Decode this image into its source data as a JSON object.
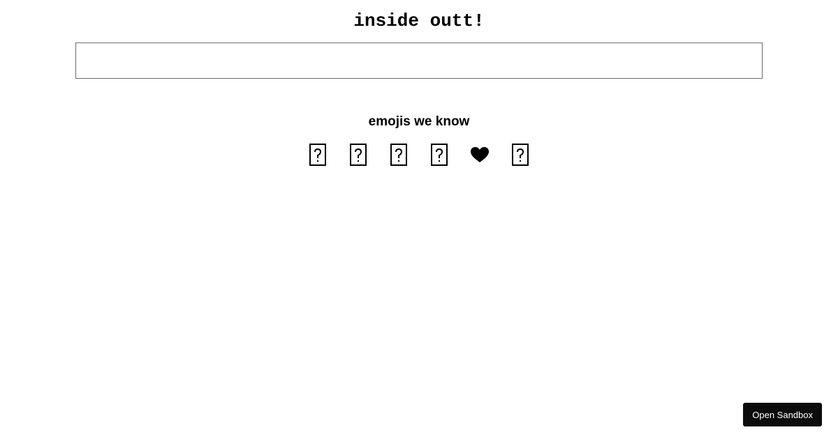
{
  "header": {
    "title": "inside outt!"
  },
  "search": {
    "value": "",
    "placeholder": ""
  },
  "emojis": {
    "heading": "emojis we know",
    "items": [
      {
        "icon": "missing-glyph-icon"
      },
      {
        "icon": "missing-glyph-icon"
      },
      {
        "icon": "missing-glyph-icon"
      },
      {
        "icon": "missing-glyph-icon"
      },
      {
        "icon": "heart-icon",
        "glyph": "❤"
      },
      {
        "icon": "missing-glyph-icon"
      }
    ]
  },
  "footer": {
    "open_sandbox_label": "Open Sandbox"
  }
}
